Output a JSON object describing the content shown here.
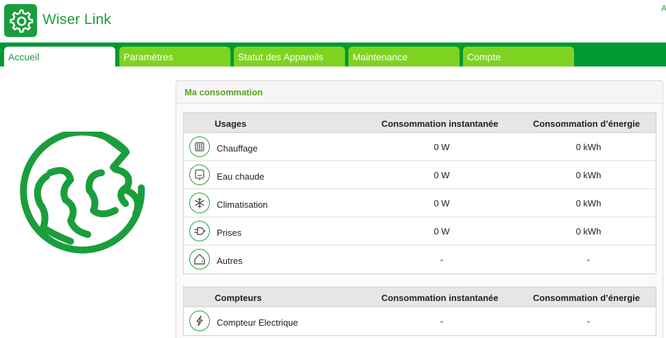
{
  "app": {
    "title": "Wiser Link",
    "corner_char": "A"
  },
  "nav": {
    "tabs": [
      {
        "label": "Accueil",
        "active": true
      },
      {
        "label": "Paramètres",
        "active": false
      },
      {
        "label": "Statut des Appareils",
        "active": false
      },
      {
        "label": "Maintenance",
        "active": false
      },
      {
        "label": "Compte",
        "active": false
      }
    ]
  },
  "panel": {
    "title": "Ma consommation",
    "usages": {
      "headers": [
        "Usages",
        "Consommation instantanée",
        "Consommation d’énergie"
      ],
      "rows": [
        {
          "icon": "radiator-icon",
          "label": "Chauffage",
          "instant": "0 W",
          "energy": "0 kWh"
        },
        {
          "icon": "water-heater-icon",
          "label": "Eau chaude",
          "instant": "0 W",
          "energy": "0 kWh"
        },
        {
          "icon": "snowflake-icon",
          "label": "Climatisation",
          "instant": "0 W",
          "energy": "0 kWh"
        },
        {
          "icon": "plug-icon",
          "label": "Prises",
          "instant": "0 W",
          "energy": "0 kWh"
        },
        {
          "icon": "house-icon",
          "label": "Autres",
          "instant": "-",
          "energy": "-"
        }
      ]
    },
    "compteurs": {
      "headers": [
        "Compteurs",
        "Consommation instantanée",
        "Consommation d’énergie"
      ],
      "rows": [
        {
          "icon": "lightning-icon",
          "label": "Compteur Electrique",
          "instant": "-",
          "energy": "-"
        }
      ]
    }
  },
  "colors": {
    "brand_green": "#1a9e3c",
    "nav_green": "#009933",
    "tab_green": "#7ed321",
    "panel_title": "#5a9e1e"
  }
}
